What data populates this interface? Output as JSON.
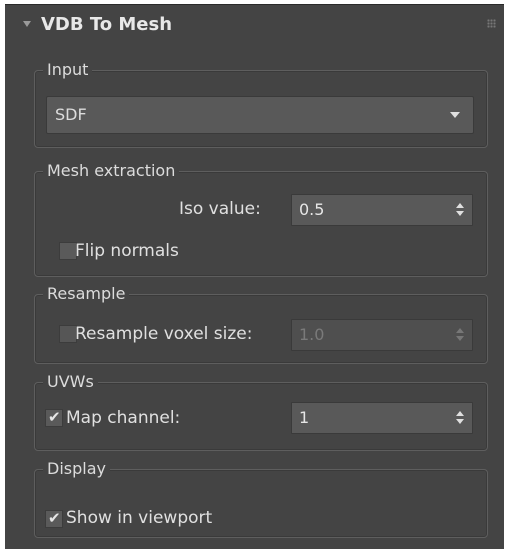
{
  "rollout": {
    "title": "VDB To Mesh",
    "collapse_icon": "triangle-down-icon",
    "grip_icon": "grip-dots-icon"
  },
  "input": {
    "label": "Input",
    "source_value": "SDF"
  },
  "mesh_extraction": {
    "label": "Mesh extraction",
    "iso_label": "Iso value:",
    "iso_value": "0.5",
    "flip_normals_label": "Flip normals",
    "flip_normals_checked": false
  },
  "resample": {
    "label": "Resample",
    "voxel_size_label": "Resample voxel size:",
    "voxel_size_value": "1.0",
    "voxel_checked": false
  },
  "uvws": {
    "label": "UVWs",
    "map_channel_label": "Map channel:",
    "map_channel_value": "1",
    "map_channel_checked": true
  },
  "display": {
    "label": "Display",
    "show_in_viewport_label": "Show in viewport",
    "show_in_viewport_checked": true
  },
  "colors": {
    "panel_bg": "#444444",
    "field_bg": "#595959",
    "text": "#dcdcdc"
  }
}
